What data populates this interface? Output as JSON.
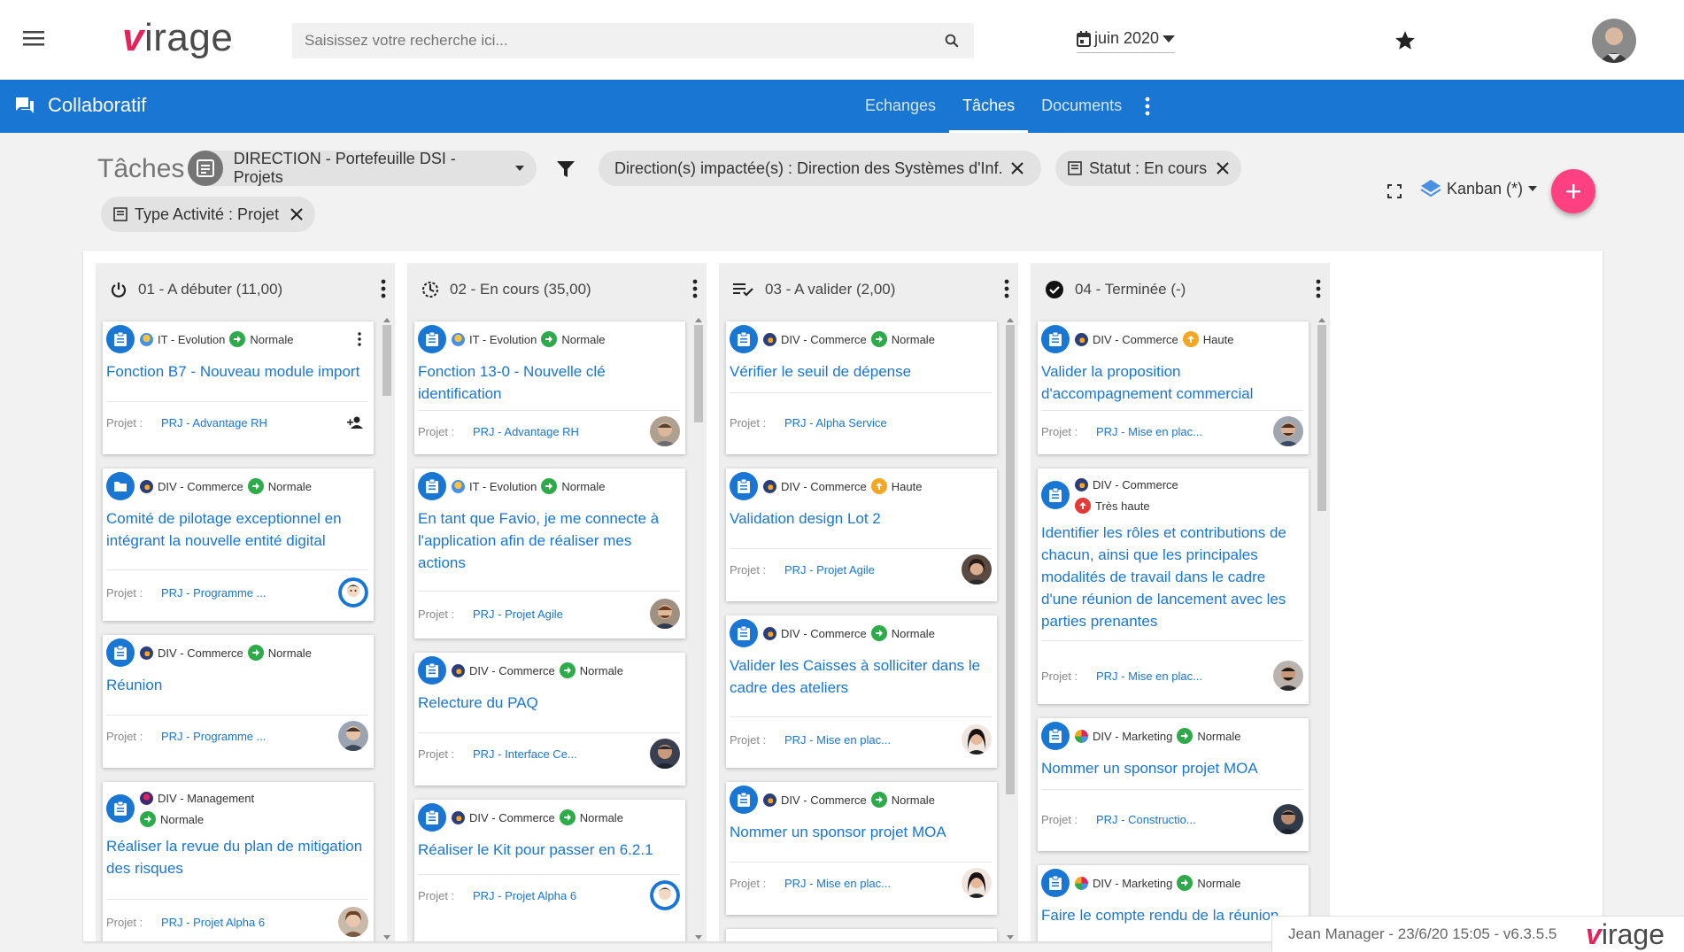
{
  "header": {
    "logo_text": "virage",
    "search_placeholder": "Saisissez votre recherche ici...",
    "date_label": "juin 2020"
  },
  "bluebar": {
    "app_name": "Collaboratif",
    "tabs": [
      {
        "label": "Echanges",
        "active": false
      },
      {
        "label": "Tâches",
        "active": true
      },
      {
        "label": "Documents",
        "active": false
      }
    ]
  },
  "filters": {
    "page_title": "Tâches",
    "portfolio": "DIRECTION - Portefeuille DSI - Projets",
    "direction": "Direction(s) impactée(s) : Direction des Systèmes d'Inf...",
    "statut": "Statut : En cours",
    "type": "Type Activité : Projet",
    "view": "Kanban (*)"
  },
  "labels": {
    "projet": "Projet :"
  },
  "colors": {
    "primary": "#1976d2",
    "accent": "#ff4081",
    "normale": "#2eaa4a",
    "haute": "#f5a623",
    "tres_haute": "#e53935"
  },
  "columns": [
    {
      "title": "01 - A débuter (11,00)",
      "icon": "power-icon",
      "cards": [
        {
          "domain": "IT - Evolution",
          "priority": "Normale",
          "title": "Fonction B7 - Nouveau module import",
          "project": "PRJ - Advantage RH"
        },
        {
          "domain": "DIV - Commerce",
          "priority": "Normale",
          "title": "Comité de pilotage exceptionnel en intégrant la nouvelle entité digital",
          "project": "PRJ - Programme ..."
        },
        {
          "domain": "DIV - Commerce",
          "priority": "Normale",
          "title": "Réunion",
          "project": "PRJ - Programme ..."
        },
        {
          "domain": "DIV - Management",
          "priority": "Normale",
          "title": "Réaliser la revue du plan de mitigation des risques",
          "project": "PRJ - Projet Alpha 6"
        }
      ]
    },
    {
      "title": "02 - En cours (35,00)",
      "icon": "progress-icon",
      "cards": [
        {
          "domain": "IT - Evolution",
          "priority": "Normale",
          "title": "Fonction 13-0 - Nouvelle clé identification",
          "project": "PRJ - Advantage RH"
        },
        {
          "domain": "IT - Evolution",
          "priority": "Normale",
          "title": "En tant que Favio, je me connecte à l'application afin de réaliser mes actions",
          "project": "PRJ - Projet Agile"
        },
        {
          "domain": "DIV - Commerce",
          "priority": "Normale",
          "title": "Relecture du PAQ",
          "project": "PRJ - Interface Ce..."
        },
        {
          "domain": "DIV - Commerce",
          "priority": "Normale",
          "title": "Réaliser le Kit pour passer en 6.2.1",
          "project": "PRJ - Projet Alpha 6"
        }
      ]
    },
    {
      "title": "03 - A valider (2,00)",
      "icon": "validate-list-icon",
      "cards": [
        {
          "domain": "DIV - Commerce",
          "priority": "Normale",
          "title": "Vérifier le seuil de dépense",
          "project": "PRJ - Alpha Service"
        },
        {
          "domain": "DIV - Commerce",
          "priority": "Haute",
          "title": "Validation design Lot 2",
          "project": "PRJ - Projet Agile"
        },
        {
          "domain": "DIV - Commerce",
          "priority": "Normale",
          "title": "Valider les Caisses à solliciter dans le cadre des ateliers",
          "project": "PRJ - Mise en plac..."
        },
        {
          "domain": "DIV - Commerce",
          "priority": "Normale",
          "title": "Nommer un sponsor projet MOA",
          "project": "PRJ - Mise en plac..."
        }
      ]
    },
    {
      "title": "04 - Terminée (-)",
      "icon": "check-circle-icon",
      "cards": [
        {
          "domain": "DIV - Commerce",
          "priority": "Haute",
          "title": "Valider la proposition d'accompagnement commercial",
          "project": "PRJ - Mise en plac..."
        },
        {
          "domain": "DIV - Commerce",
          "priority": "Très haute",
          "title": "Identifier les rôles et contributions de chacun, ainsi que les principales modalités de travail dans le cadre d'une réunion de lancement avec les parties prenantes",
          "project": "PRJ - Mise en plac..."
        },
        {
          "domain": "DIV - Marketing",
          "priority": "Normale",
          "title": "Nommer un sponsor projet MOA",
          "project": "PRJ - Constructio..."
        },
        {
          "domain": "DIV - Marketing",
          "priority": "Normale",
          "title": "Faire le compte rendu de la réunion",
          "project": ""
        }
      ]
    }
  ],
  "footer": {
    "text": "Jean Manager - 23/6/20 15:05 - v6.3.5.5",
    "logo": "virage"
  }
}
